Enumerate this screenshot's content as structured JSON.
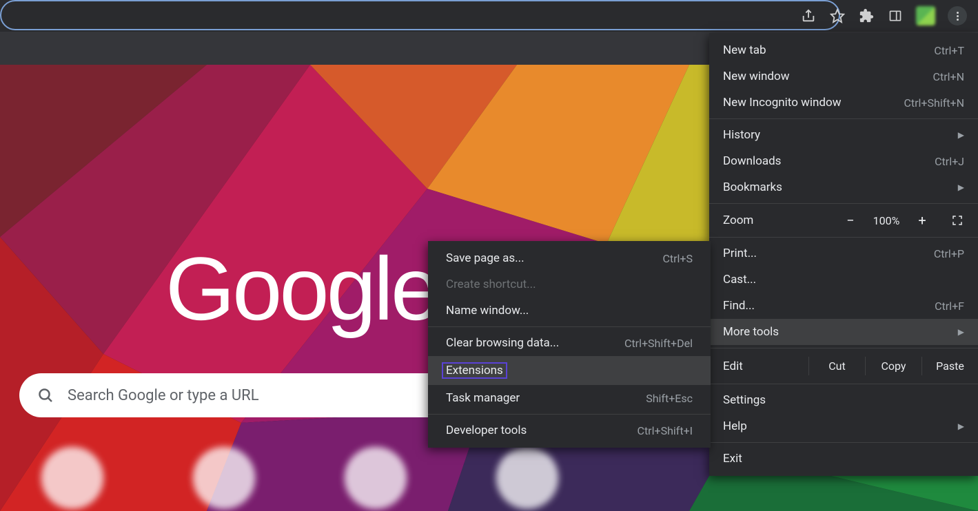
{
  "toolbar": {
    "icons": {
      "share": "share-icon",
      "star": "star-icon",
      "puzzle": "extensions-icon",
      "panel": "sidepanel-icon",
      "kebab": "menu-icon"
    }
  },
  "search": {
    "placeholder": "Search Google or type a URL"
  },
  "logo": "Google",
  "menu": {
    "new_tab": {
      "label": "New tab",
      "shortcut": "Ctrl+T"
    },
    "new_window": {
      "label": "New window",
      "shortcut": "Ctrl+N"
    },
    "new_incognito": {
      "label": "New Incognito window",
      "shortcut": "Ctrl+Shift+N"
    },
    "history": {
      "label": "History"
    },
    "downloads": {
      "label": "Downloads",
      "shortcut": "Ctrl+J"
    },
    "bookmarks": {
      "label": "Bookmarks"
    },
    "zoom": {
      "label": "Zoom",
      "minus": "−",
      "value": "100%",
      "plus": "+"
    },
    "print": {
      "label": "Print...",
      "shortcut": "Ctrl+P"
    },
    "cast": {
      "label": "Cast..."
    },
    "find": {
      "label": "Find...",
      "shortcut": "Ctrl+F"
    },
    "more_tools": {
      "label": "More tools"
    },
    "edit": {
      "label": "Edit",
      "cut": "Cut",
      "copy": "Copy",
      "paste": "Paste"
    },
    "settings": {
      "label": "Settings"
    },
    "help": {
      "label": "Help"
    },
    "exit": {
      "label": "Exit"
    }
  },
  "submenu": {
    "save_page": {
      "label": "Save page as...",
      "shortcut": "Ctrl+S"
    },
    "create_shortcut": {
      "label": "Create shortcut..."
    },
    "name_window": {
      "label": "Name window..."
    },
    "clear_data": {
      "label": "Clear browsing data...",
      "shortcut": "Ctrl+Shift+Del"
    },
    "extensions": {
      "label": "Extensions"
    },
    "task_manager": {
      "label": "Task manager",
      "shortcut": "Shift+Esc"
    },
    "dev_tools": {
      "label": "Developer tools",
      "shortcut": "Ctrl+Shift+I"
    }
  }
}
